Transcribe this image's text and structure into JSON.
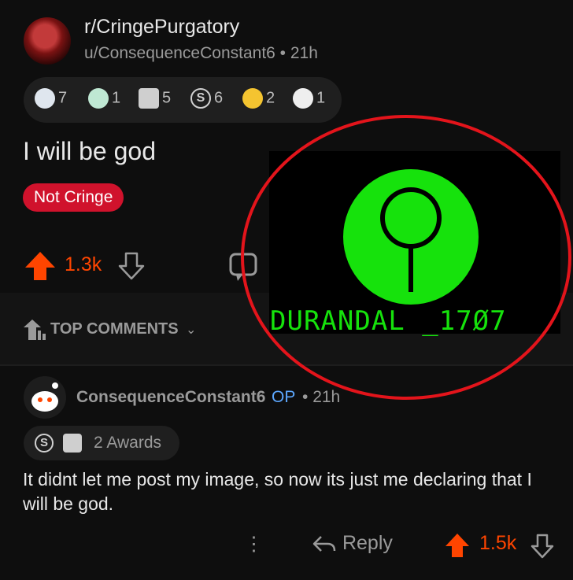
{
  "post": {
    "subreddit": "r/CringePurgatory",
    "username": "u/ConsequenceConstant6",
    "separator": " • ",
    "age": "21h",
    "awards": [
      {
        "icon": "laughing-award-icon",
        "count": "7",
        "color": "#dfe6ee"
      },
      {
        "icon": "angel-award-icon",
        "count": "1",
        "color": "#cfeee0"
      },
      {
        "icon": "handshake-award-icon",
        "count": "5",
        "color": "#d8d8d8"
      },
      {
        "icon": "silver-s-award-icon",
        "count": "6",
        "color": "#d0d0d0"
      },
      {
        "icon": "helpful-gold-award-icon",
        "count": "2",
        "color": "#f4c430"
      },
      {
        "icon": "snoo-award-icon",
        "count": "1",
        "color": "#eeeeee"
      }
    ],
    "title": "I will be god",
    "flair": "Not Cringe",
    "score": "1.3k",
    "image_text": "DURANDAL _17Ø7"
  },
  "section": {
    "label": "TOP COMMENTS",
    "chevron": "⌄"
  },
  "comment": {
    "username": "ConsequenceConstant6",
    "op_badge": "OP",
    "dot": " • ",
    "age": "21h",
    "awards_label": "2 Awards",
    "body": "It didnt let me post my image, so now its just me declaring that I will be god.",
    "more": "⋮",
    "reply": "Reply",
    "score": "1.5k"
  },
  "colors": {
    "accent": "#ff4500",
    "flair": "#d0122c",
    "op": "#5da8ff",
    "logo_green": "#16e20c",
    "circle_red": "#e3141b"
  }
}
